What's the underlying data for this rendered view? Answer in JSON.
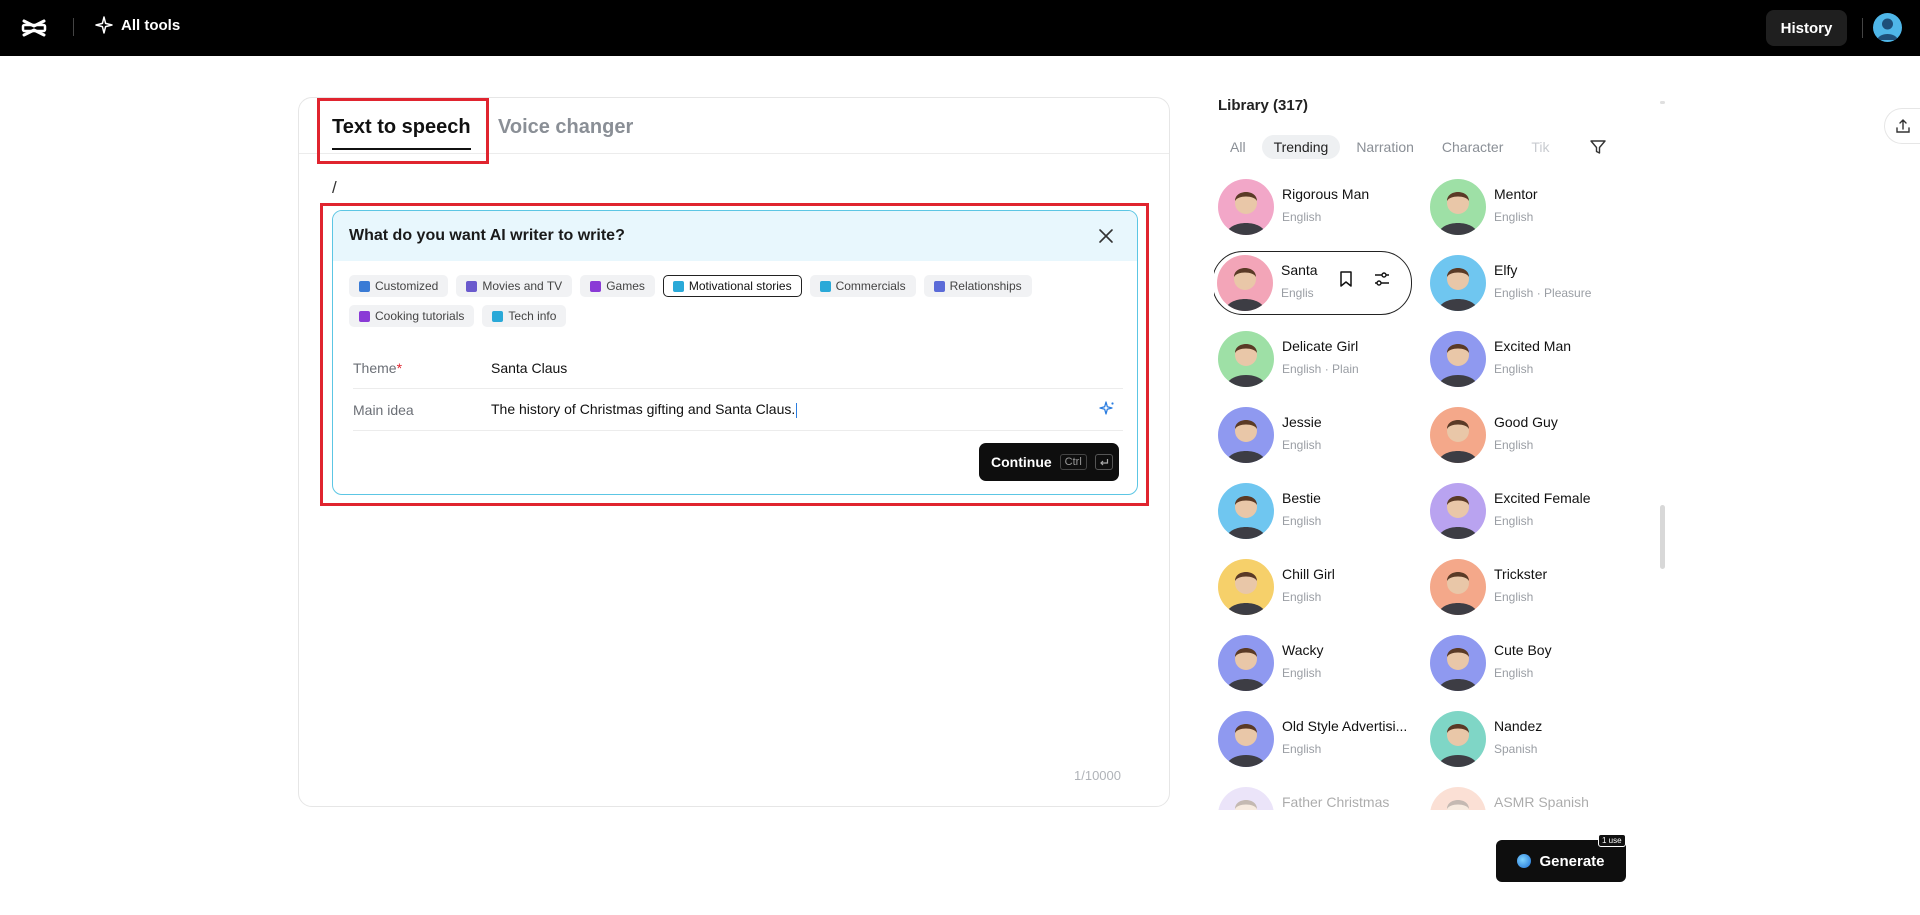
{
  "topbar": {
    "all_tools_label": "All tools",
    "history_label": "History"
  },
  "editor": {
    "tabs": [
      {
        "label": "Text to speech",
        "active": true
      },
      {
        "label": "Voice changer",
        "active": false
      }
    ],
    "slash": "/",
    "counter": "1/10000"
  },
  "ai_writer": {
    "title": "What do you want AI writer to write?",
    "chips": [
      {
        "label": "Customized",
        "color": "#3a7bd5",
        "selected": false
      },
      {
        "label": "Movies and TV",
        "color": "#6a5acd",
        "selected": false
      },
      {
        "label": "Games",
        "color": "#8a3ad6",
        "selected": false
      },
      {
        "label": "Motivational stories",
        "color": "#2aa9d8",
        "selected": true
      },
      {
        "label": "Commercials",
        "color": "#2aa9d8",
        "selected": false
      },
      {
        "label": "Relationships",
        "color": "#5b6bd8",
        "selected": false
      },
      {
        "label": "Cooking tutorials",
        "color": "#8a3ad6",
        "selected": false
      },
      {
        "label": "Tech info",
        "color": "#2aa9d8",
        "selected": false
      }
    ],
    "theme_label": "Theme",
    "theme_required": "*",
    "theme_value": "Santa Claus",
    "main_idea_label": "Main idea",
    "main_idea_value": "The history of Christmas gifting and Santa Claus.",
    "continue_label": "Continue",
    "continue_kbd": "Ctrl"
  },
  "library": {
    "title": "Library (317)",
    "tabs": [
      "All",
      "Trending",
      "Narration",
      "Character",
      "Tik"
    ],
    "active_tab": "Trending",
    "voices": [
      {
        "name": "Rigorous Man",
        "sub": "English",
        "color": "#f2a7c8"
      },
      {
        "name": "Mentor",
        "sub": "English",
        "color": "#9ee0a6"
      },
      {
        "name": "Santa",
        "sub": "Englis",
        "color": "#f3a5b8",
        "hover": true
      },
      {
        "name": "Elfy",
        "sub": "English · Pleasure",
        "color": "#6fc6f0"
      },
      {
        "name": "Delicate Girl",
        "sub": "English · Plain",
        "color": "#9ee0a6"
      },
      {
        "name": "Excited Man",
        "sub": "English",
        "color": "#8f99f0"
      },
      {
        "name": "Jessie",
        "sub": "English",
        "color": "#8f99f0"
      },
      {
        "name": "Good Guy",
        "sub": "English",
        "color": "#f4a88a"
      },
      {
        "name": "Bestie",
        "sub": "English",
        "color": "#6fc6f0"
      },
      {
        "name": "Excited Female",
        "sub": "English",
        "color": "#b9a3f0"
      },
      {
        "name": "Chill Girl",
        "sub": "English",
        "color": "#f6d06a"
      },
      {
        "name": "Trickster",
        "sub": "English",
        "color": "#f4a88a"
      },
      {
        "name": "Wacky",
        "sub": "English",
        "color": "#8f99f0"
      },
      {
        "name": "Cute Boy",
        "sub": "English",
        "color": "#8f99f0"
      },
      {
        "name": "Old Style Advertisi...",
        "sub": "English",
        "color": "#8f99f0"
      },
      {
        "name": "Nandez",
        "sub": "Spanish",
        "color": "#7fd6c6"
      },
      {
        "name": "Father Christmas",
        "sub": "",
        "color": "#c8b3f0",
        "faded": true
      },
      {
        "name": "ASMR Spanish",
        "sub": "",
        "color": "#f4a88a",
        "faded": true
      }
    ]
  },
  "generate": {
    "label": "Generate",
    "badge": "1 use"
  }
}
